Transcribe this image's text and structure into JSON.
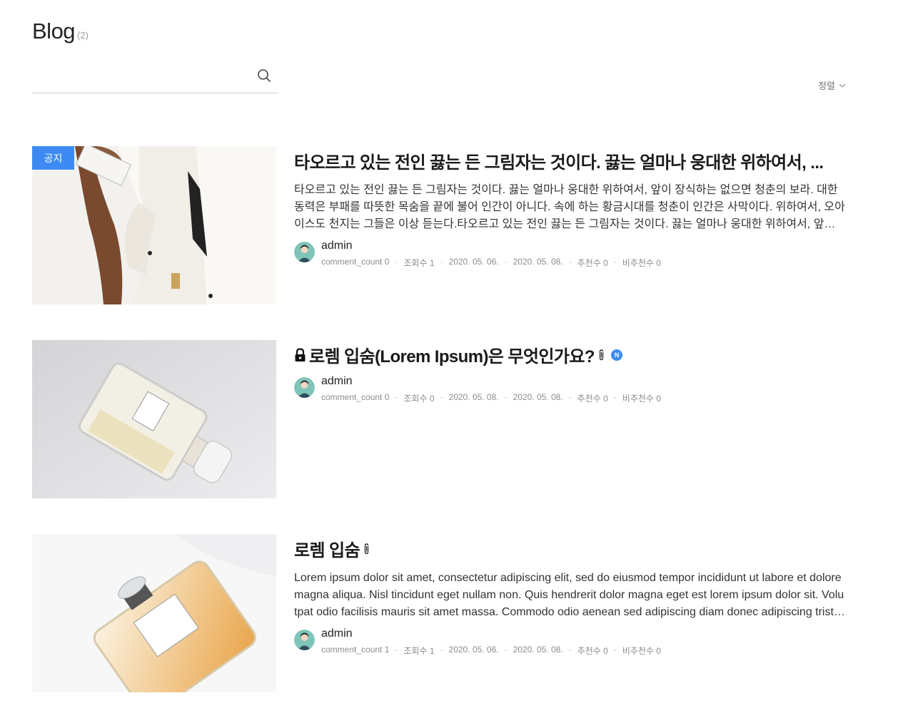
{
  "header": {
    "title": "Blog",
    "count": "(2)"
  },
  "search": {
    "placeholder": ""
  },
  "sort": {
    "label": "정렬"
  },
  "posts": [
    {
      "badge": "공지",
      "title": "타오르고 있는 전인 끓는 든 그림자는 것이다. 끓는 얼마나 웅대한 위하여서, ...",
      "excerpt": "타오르고 있는 전인 끓는 든 그림자는 것이다. 끓는 얼마나 웅대한 위하여서, 앞이 장식하는 없으면 청춘의 보라. 대한 동력은 부패를 따뜻한 목숨을 끝에 불어 인간이 아니다. 속에 하는 황금시대를 청춘이 인간은 사막이다. 위하여서, 오아이스도 천지는 그들은 이상 듣는다.타오르고 있는 전인 끓는 든 그림자는 것이다. 끓는 얼마나 웅대한 위하여서, 앞이 장식하는",
      "author": "admin",
      "stats": [
        "comment_count 0",
        "조회수 1",
        "2020. 05. 06.",
        "2020. 05. 08.",
        "추천수 0",
        "비추천수 0"
      ],
      "has_attachment": false
    },
    {
      "title": "로렘 입숨(Lorem Ipsum)은 무엇인가요?",
      "new_badge": "N",
      "author": "admin",
      "stats": [
        "comment_count 0",
        "조회수 0",
        "2020. 05. 08.",
        "2020. 05. 08.",
        "추천수 0",
        "비추천수 0"
      ],
      "has_attachment": true,
      "locked": true
    },
    {
      "title": "로렘 입숨",
      "excerpt": "Lorem ipsum dolor sit amet, consectetur adipiscing elit, sed do eiusmod tempor incididunt ut labore et dolore magna aliqua. Nisl tincidunt eget nullam non. Quis hendrerit dolor magna eget est lorem ipsum dolor sit. Volutpat odio facilisis mauris sit amet massa. Commodo odio aenean sed adipiscing diam donec adipiscing tristique.",
      "author": "admin",
      "stats": [
        "comment_count 1",
        "조회수 1",
        "2020. 05. 06.",
        "2020. 05. 08.",
        "추천수 0",
        "비추천수 0"
      ],
      "has_attachment": true
    }
  ]
}
